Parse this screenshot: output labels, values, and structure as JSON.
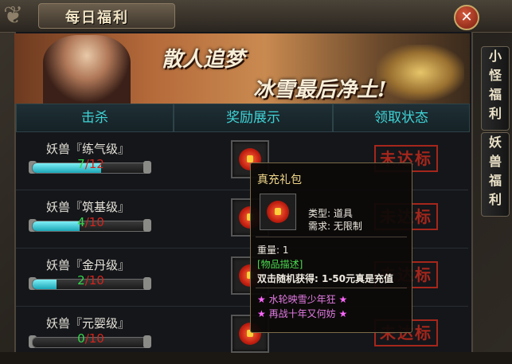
{
  "window": {
    "title": "每日福利",
    "close_label": "✕"
  },
  "banner": {
    "line1": "散人追梦",
    "line2": "冰雪最后净土!"
  },
  "columns": {
    "kill": "击杀",
    "reward": "奖励展示",
    "status": "领取状态"
  },
  "side_tabs": [
    {
      "label": [
        "小",
        "怪",
        "福",
        "利"
      ]
    },
    {
      "label": [
        "妖",
        "兽",
        "福",
        "利"
      ]
    }
  ],
  "rows": [
    {
      "name": "妖兽『练气级』",
      "current": "7",
      "total": "/12",
      "progress": 0.5833,
      "status": "未达标"
    },
    {
      "name": "妖兽『筑基级』",
      "current": "4",
      "total": "/10",
      "progress": 0.4,
      "status": "未达标"
    },
    {
      "name": "妖兽『金丹级』",
      "current": "2",
      "total": "/10",
      "progress": 0.2,
      "status": "未达标"
    },
    {
      "name": "妖兽『元婴级』",
      "current": "0",
      "total": "/10",
      "progress": 0.0,
      "status": "未达标"
    }
  ],
  "tooltip": {
    "title": "真充礼包",
    "type": "类型: 道具",
    "require": "需求: 无限制",
    "weight": "重量: 1",
    "desc_tag": "[物品描述]",
    "desc": "双击随机获得: 1-50元真是充值",
    "line1": "水轮映雪少年狂",
    "line2": "再战十年又何妨",
    "star": "★"
  },
  "colors": {
    "accent": "#3fd3d6",
    "stamp": "#b5281c",
    "progress": "#1ba6b8"
  }
}
